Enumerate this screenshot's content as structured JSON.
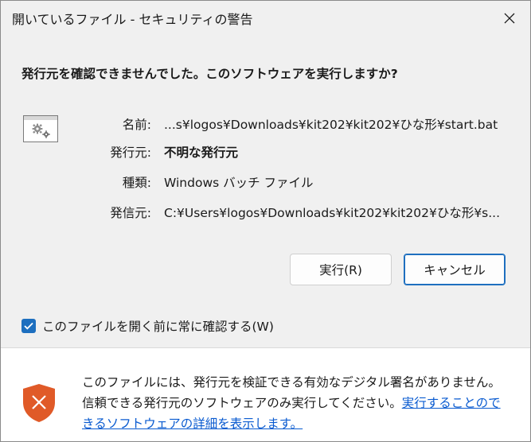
{
  "window": {
    "title": "開いているファイル - セキュリティの警告"
  },
  "dialog": {
    "question": "発行元を確認できませんでした。このソフトウェアを実行しますか?",
    "info": {
      "name_label": "名前:",
      "name_value": "...s¥logos¥Downloads¥kit202¥kit202¥ひな形¥start.bat",
      "publisher_label": "発行元:",
      "publisher_value": "不明な発行元",
      "type_label": "種類:",
      "type_value": "Windows バッチ ファイル",
      "from_label": "発信元:",
      "from_value": "C:¥Users¥logos¥Downloads¥kit202¥kit202¥ひな形¥s..."
    },
    "run_button": "実行(R)",
    "cancel_button": "キャンセル",
    "checkbox_label": "このファイルを開く前に常に確認する(W)",
    "checkbox_checked": true
  },
  "footer": {
    "warning_text": "このファイルには、発行元を検証できる有効なデジタル署名がありません。信頼できる発行元のソフトウェアのみ実行してください。",
    "link_text": "実行することのできるソフトウェアの詳細を表示します。"
  },
  "colors": {
    "accent": "#1d6fbf",
    "link": "#0a5bd0",
    "shield": "#e05a28"
  },
  "icons": {
    "close": "close-icon",
    "file": "gear-file-icon",
    "checkbox": "checkmark-icon",
    "shield": "shield-warning-icon"
  }
}
